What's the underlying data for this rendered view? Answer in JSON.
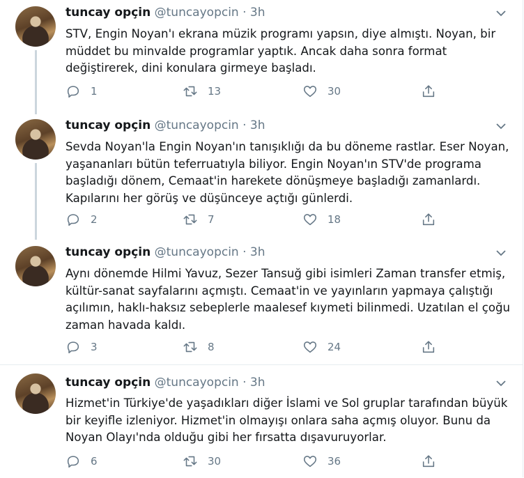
{
  "tweets": [
    {
      "name": "tuncay opçin",
      "handle": "@tuncayopcin",
      "separator": "·",
      "time": "3h",
      "text": "STV, Engin Noyan'ı ekrana müzik programı yapsın, diye almıştı. Noyan, bir müddet bu minvalde programlar yaptık. Ancak daha sonra format değiştirerek, dini konulara girmeye başladı.",
      "replies": "1",
      "retweets": "13",
      "likes": "30"
    },
    {
      "name": "tuncay opçin",
      "handle": "@tuncayopcin",
      "separator": "·",
      "time": "3h",
      "text": "Sevda Noyan'la Engin Noyan'ın tanışıklığı da bu döneme rastlar. Eser Noyan, yaşananları bütün teferruatıyla biliyor. Engin Noyan'ın STV'de programa başladığı dönem, Cemaat'in harekete dönüşmeye başladığı zamanlardı. Kapılarını her görüş ve düşünceye açtığı günlerdi.",
      "replies": "2",
      "retweets": "7",
      "likes": "18"
    },
    {
      "name": "tuncay opçin",
      "handle": "@tuncayopcin",
      "separator": "·",
      "time": "3h",
      "text": "Aynı dönemde Hilmi Yavuz, Sezer Tansuğ gibi isimleri Zaman transfer etmiş, kültür-sanat sayfalarını açmıştı. Cemaat'in ve yayınların yapmaya çalıştığı açılımın, haklı-haksız sebeplerle maalesef kıymeti bilinmedi. Uzatılan el çoğu zaman havada kaldı.",
      "replies": "3",
      "retweets": "8",
      "likes": "24"
    },
    {
      "name": "tuncay opçin",
      "handle": "@tuncayopcin",
      "separator": "·",
      "time": "3h",
      "text": "Hizmet'in Türkiye'de yaşadıkları diğer İslami ve Sol gruplar tarafından büyük bir keyifle izleniyor. Hizmet'in olmayışı onlara saha açmış oluyor. Bunu da Noyan Olayı'nda olduğu gibi her fırsatta dışavuruyorlar.",
      "replies": "6",
      "retweets": "30",
      "likes": "36"
    }
  ],
  "icons": {
    "reply": "reply-icon",
    "retweet": "retweet-icon",
    "like": "like-icon",
    "share": "share-icon",
    "menu": "chevron-down-icon"
  },
  "colors": {
    "text": "#14171a",
    "secondary": "#657786",
    "thread_line": "#ccd6dd",
    "border": "#e6ecf0"
  }
}
